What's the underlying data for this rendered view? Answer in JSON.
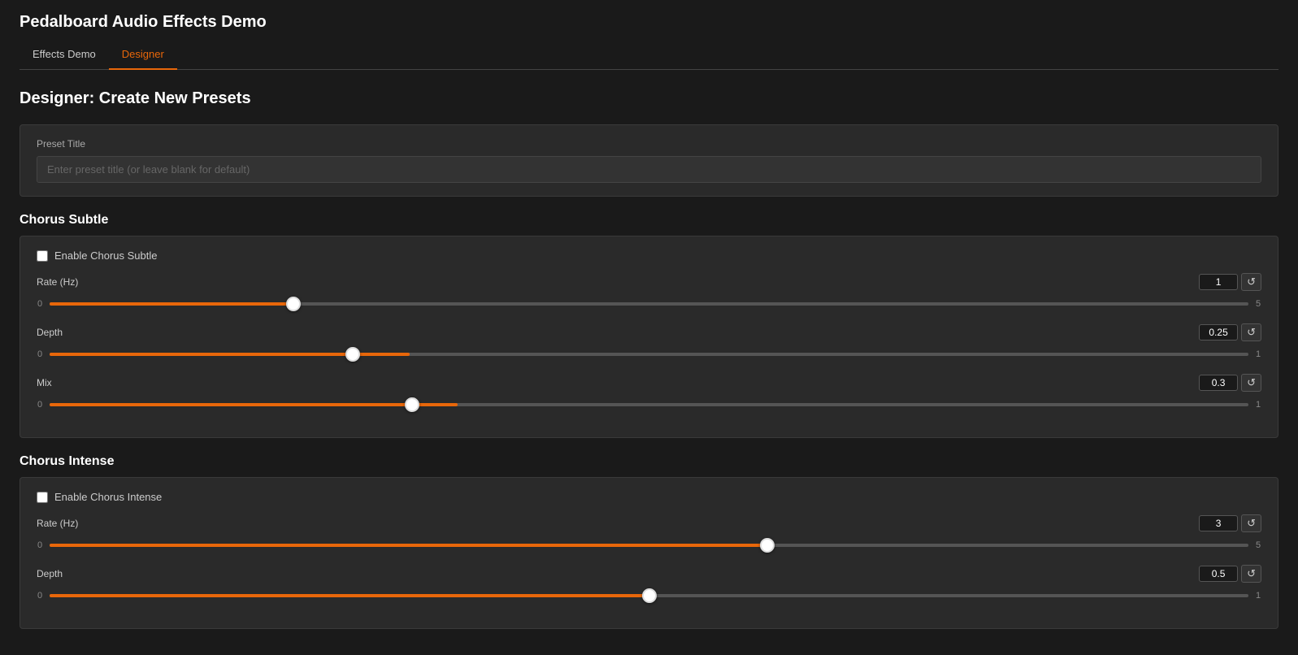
{
  "app": {
    "title": "Pedalboard Audio Effects Demo"
  },
  "tabs": [
    {
      "id": "effects-demo",
      "label": "Effects Demo",
      "active": false
    },
    {
      "id": "designer",
      "label": "Designer",
      "active": true
    }
  ],
  "designer": {
    "page_title": "Designer: Create New Presets",
    "preset_section": {
      "label": "Preset Title",
      "placeholder": "Enter preset title (or leave blank for default)"
    },
    "sections": [
      {
        "id": "chorus-subtle",
        "title": "Chorus Subtle",
        "enable_label": "Enable Chorus Subtle",
        "enabled": false,
        "sliders": [
          {
            "id": "rate-hz-subtle",
            "label": "Rate (Hz)",
            "min": 0,
            "max": 5,
            "value": 1,
            "fill_pct": 20
          },
          {
            "id": "depth-subtle",
            "label": "Depth",
            "min": 0,
            "max": 1,
            "value": 0.25,
            "fill_pct": 30
          },
          {
            "id": "mix-subtle",
            "label": "Mix",
            "min": 0,
            "max": 1,
            "value": 0.3,
            "fill_pct": 34
          }
        ]
      },
      {
        "id": "chorus-intense",
        "title": "Chorus Intense",
        "enable_label": "Enable Chorus Intense",
        "enabled": false,
        "sliders": [
          {
            "id": "rate-hz-intense",
            "label": "Rate (Hz)",
            "min": 0,
            "max": 5,
            "value": 3,
            "fill_pct": 60
          },
          {
            "id": "depth-intense",
            "label": "Depth",
            "min": 0,
            "max": 1,
            "value": 0.5,
            "fill_pct": 50
          }
        ]
      }
    ]
  },
  "icons": {
    "reset": "↺"
  }
}
